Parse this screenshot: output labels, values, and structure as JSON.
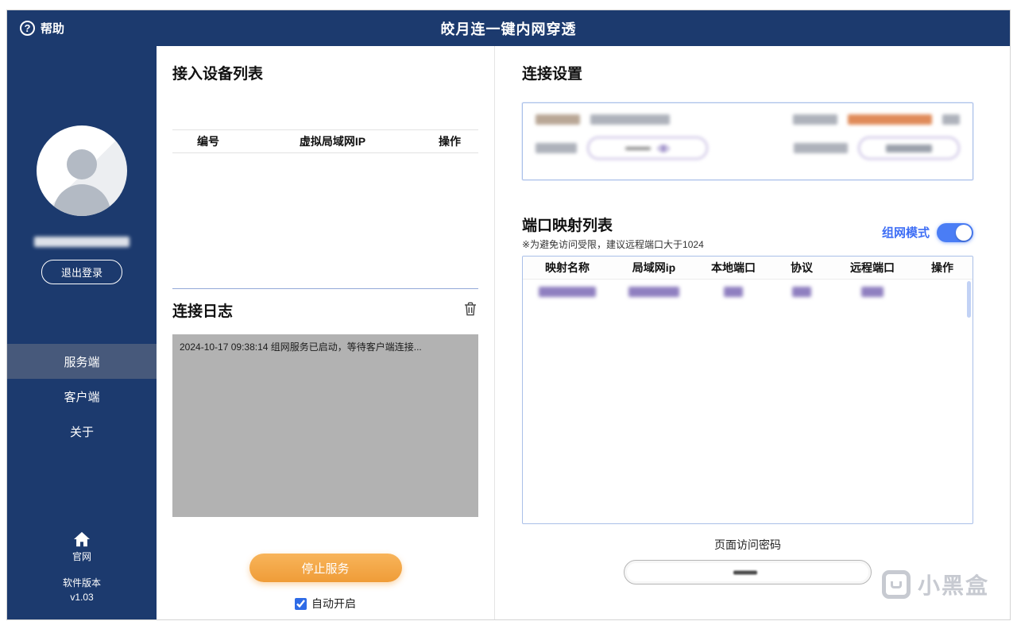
{
  "icons": {
    "help_glyph": "?",
    "help": "question-circle",
    "delete_log": "trash",
    "website": "home",
    "connection_eye": "eye"
  },
  "titlebar": {
    "help_label": "帮助",
    "title": "皎月连一键内网穿透"
  },
  "sidebar": {
    "logout_label": "退出登录",
    "menu": [
      {
        "label": "服务端",
        "active": true
      },
      {
        "label": "客户端",
        "active": false
      },
      {
        "label": "关于",
        "active": false
      }
    ],
    "website_label": "官网",
    "version_label": "软件版本",
    "version_value": "v1.03"
  },
  "devices": {
    "title": "接入设备列表",
    "columns": [
      "编号",
      "虚拟局域网IP",
      "操作"
    ],
    "rows": []
  },
  "log": {
    "title": "连接日志",
    "entries": [
      "2024-10-17 09:38:14 组网服务已启动，等待客户端连接..."
    ]
  },
  "service": {
    "stop_button_label": "停止服务",
    "auto_start_label": "自动开启",
    "auto_start_checked": true
  },
  "connection_settings": {
    "title": "连接设置",
    "content_redacted": true
  },
  "port_mapping": {
    "title": "端口映射列表",
    "note": "※为避免访问受限，建议远程端口大于1024",
    "mode_label": "组网模式",
    "mode_enabled": true,
    "columns": [
      "映射名称",
      "局域网ip",
      "本地端口",
      "协议",
      "远程端口",
      "操作"
    ],
    "redacted_row_count": 1
  },
  "page_password": {
    "label": "页面访问密码",
    "value_redacted": true
  },
  "watermark": {
    "text": "小黑盒"
  },
  "colors": {
    "topbar": "#1c3a6e",
    "sidebar_active": "#47597b",
    "accent_blue": "#3e6ef5",
    "button_orange": "#f5a844",
    "log_bg": "#b2b2b2",
    "panel_border": "#a9bfe8"
  }
}
